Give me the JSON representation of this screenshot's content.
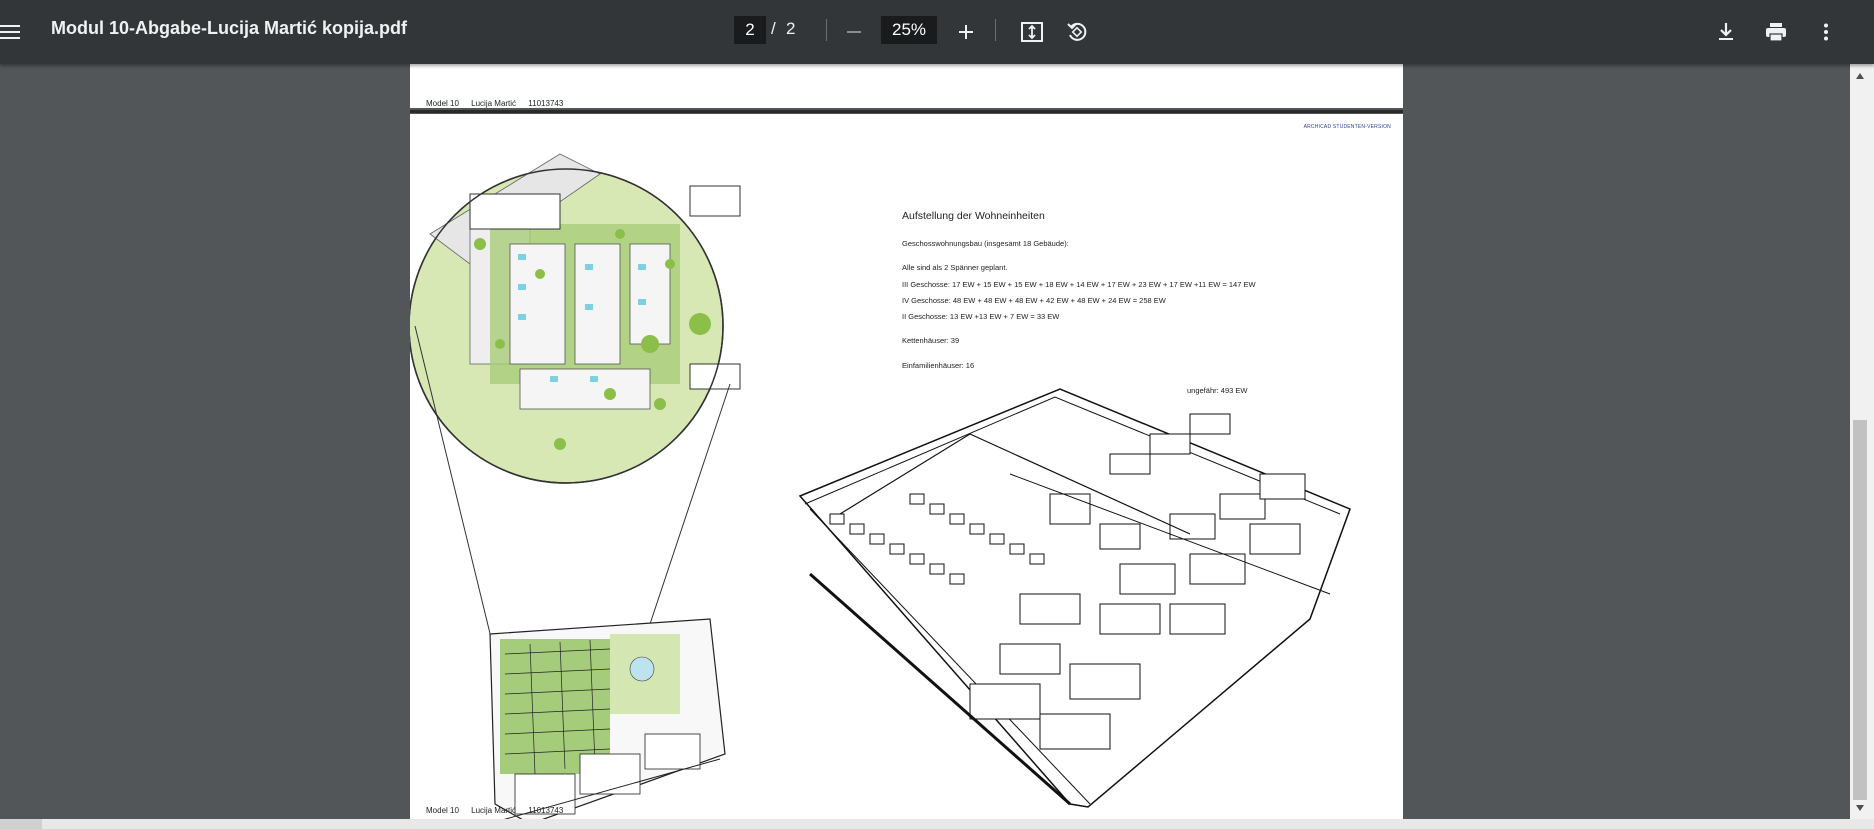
{
  "toolbar": {
    "menu_icon": "hamburger-menu-icon",
    "title": "Modul 10-Abgabe-Lucija Martić kopija.pdf",
    "current_page": "2",
    "separator": "/",
    "total_pages": "2",
    "zoom": "25%",
    "icons": [
      "minus-icon",
      "plus-icon",
      "fit-page-icon",
      "rotate-icon",
      "download-icon",
      "print-icon",
      "more-vert-icon"
    ]
  },
  "page_header": {
    "module": "Model 10",
    "author": "Lucija Martić",
    "id": "11013743"
  },
  "sheet": {
    "watermark": "ARCHICAD STUDENTEN-VERSION",
    "heading": "Aufstellung der Wohneinheiten",
    "lines": [
      "Geschosswohnungsbau (insgesamt 18 Gebäude):",
      "Alle sind als 2 Spänner geplant.",
      "III Geschosse: 17 EW + 15 EW + 15 EW + 18 EW + 14 EW + 17 EW + 23 EW + 17 EW +11 EW = 147 EW",
      "IV Geschosse: 48 EW + 48 EW + 48 EW + 42 EW + 48 EW + 24 EW = 258 EW",
      "II Geschosse: 13 EW +13 EW + 7 EW = 33 EW",
      "Kettenhäuser: 39",
      "Einfamilienhäuser: 16",
      "ungefähr: 493 EW"
    ]
  },
  "page_footer": {
    "module": "Model 10",
    "author": "Lucija Martić",
    "id": "11013743"
  }
}
